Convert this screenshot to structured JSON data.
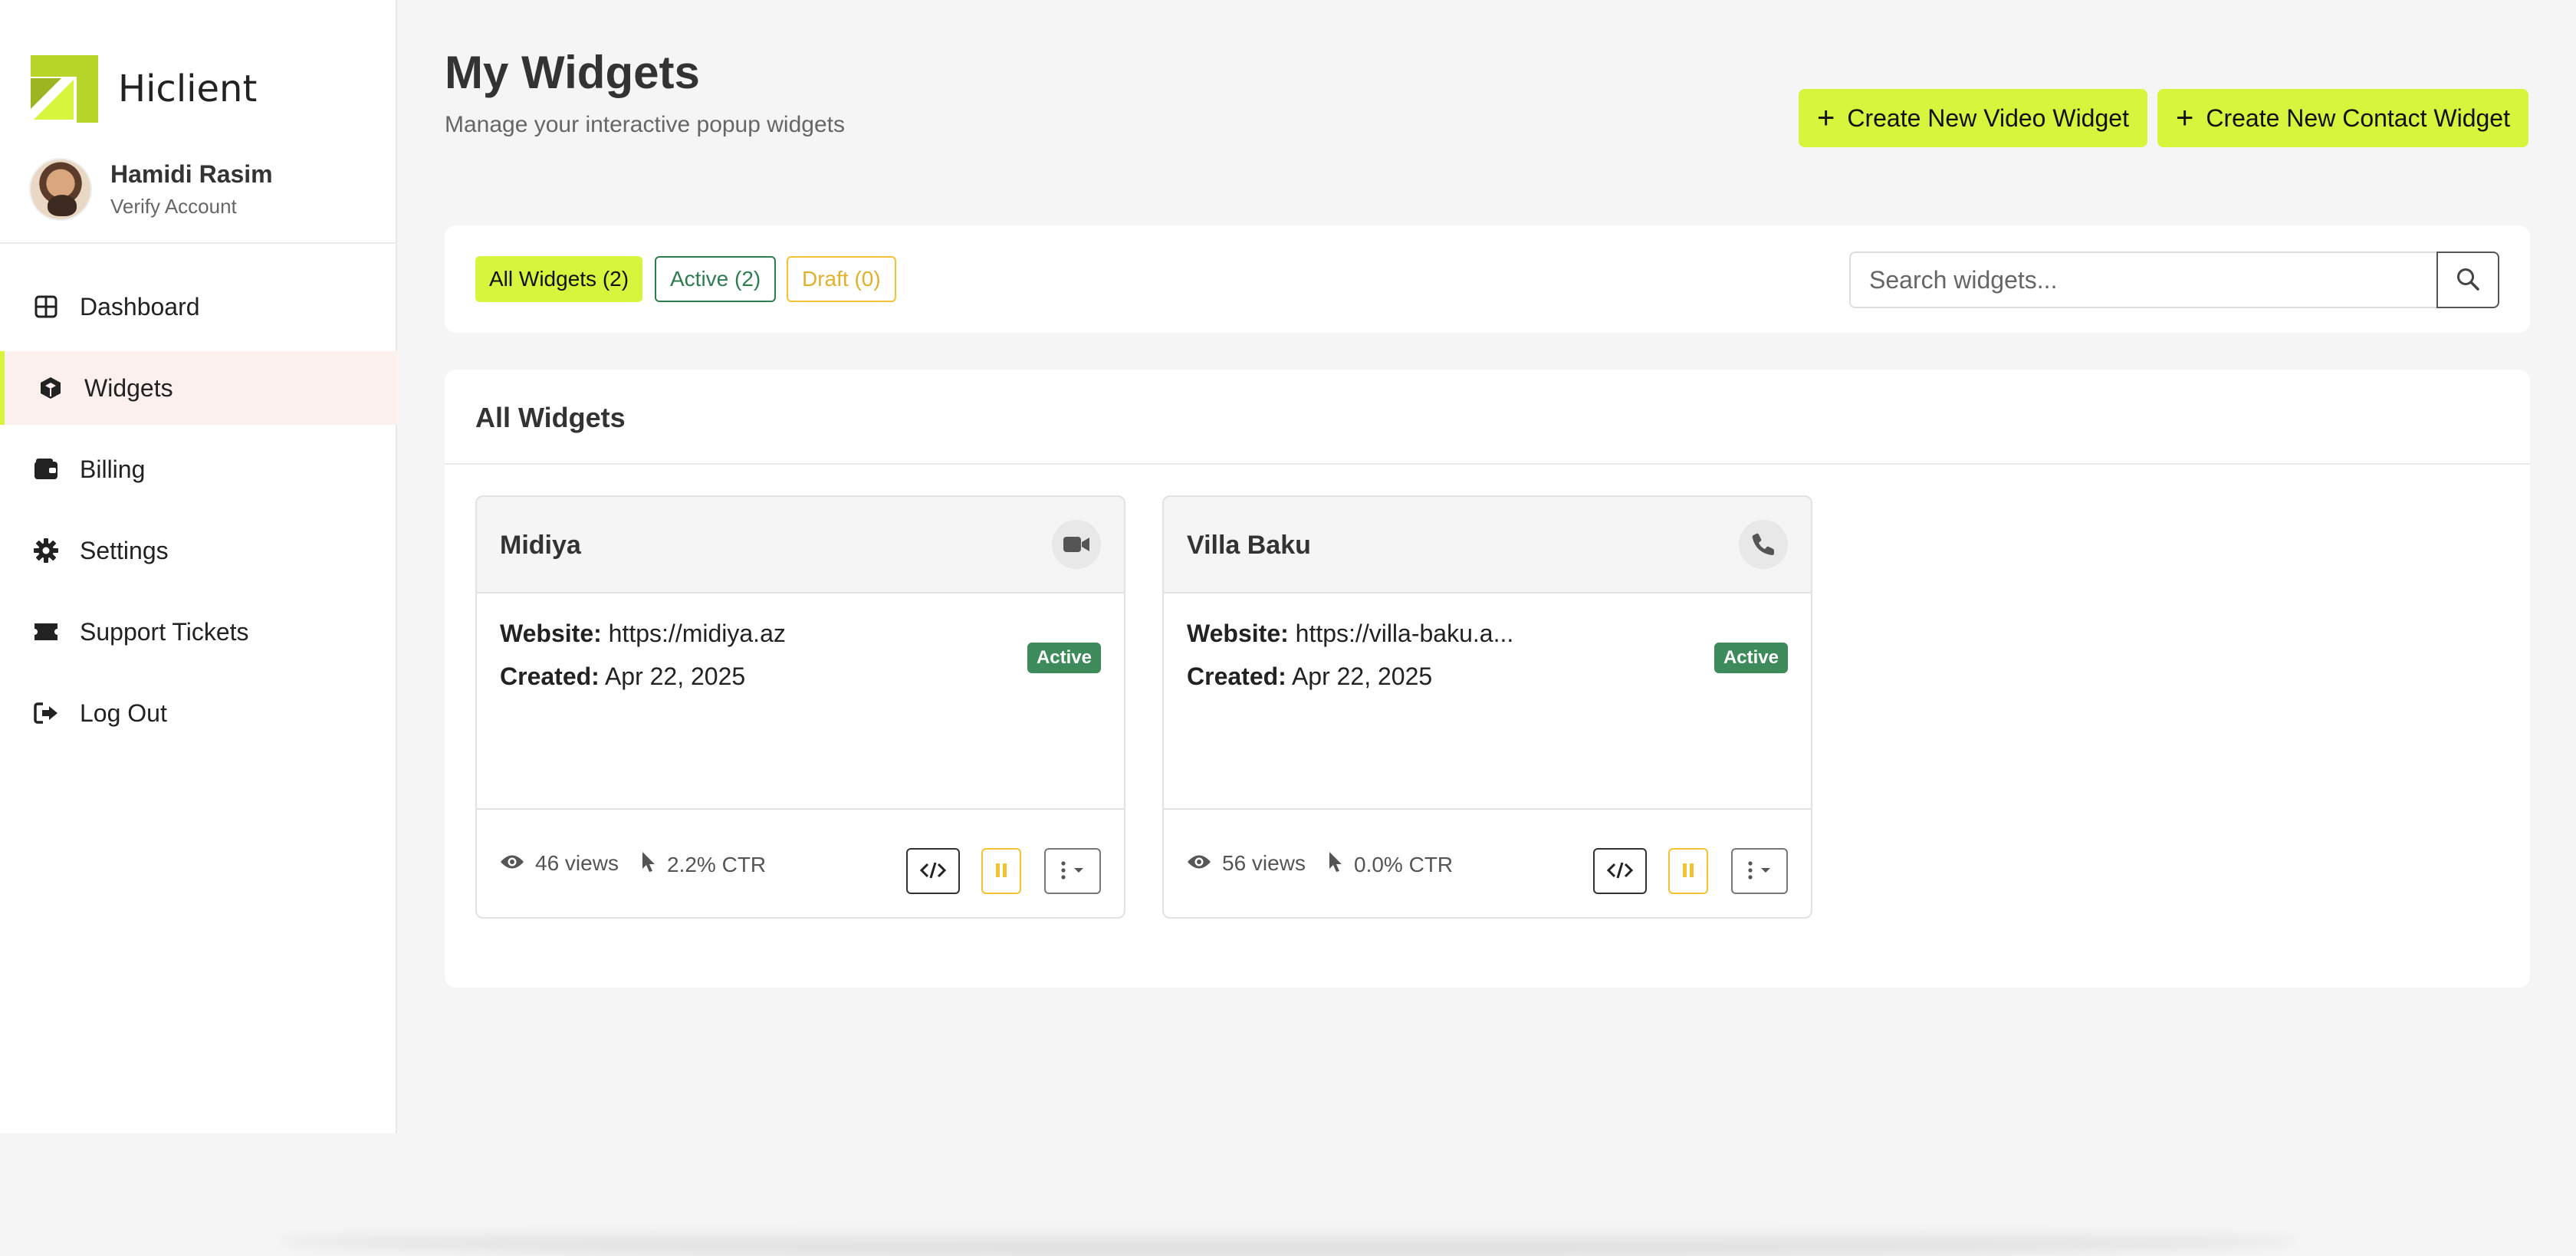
{
  "brand": {
    "name": "Hiclient",
    "accent": "#d6f53c"
  },
  "profile": {
    "name": "Hamidi Rasim",
    "subtitle": "Verify Account"
  },
  "nav": {
    "items": [
      {
        "label": "Dashboard",
        "icon": "grid-icon"
      },
      {
        "label": "Widgets",
        "icon": "cube-icon",
        "active": true
      },
      {
        "label": "Billing",
        "icon": "wallet-icon"
      },
      {
        "label": "Settings",
        "icon": "gear-icon"
      },
      {
        "label": "Support Tickets",
        "icon": "ticket-icon"
      },
      {
        "label": "Log Out",
        "icon": "logout-icon"
      }
    ]
  },
  "header": {
    "title": "My Widgets",
    "subtitle": "Manage your interactive popup widgets",
    "btn_video": "Create New Video Widget",
    "btn_contact": "Create New Contact Widget",
    "plus": "+"
  },
  "filters": {
    "all": "All Widgets (2)",
    "active": "Active (2)",
    "draft": "Draft (0)"
  },
  "search": {
    "placeholder": "Search widgets...",
    "value": ""
  },
  "widgets_panel": {
    "title": "All Widgets",
    "cards": [
      {
        "name": "Midiya",
        "type_icon": "video-camera-icon",
        "website_label": "Website:",
        "website": "https://midiya.az",
        "created_label": "Created:",
        "created": "Apr 22, 2025",
        "status": "Active",
        "views": "46 views",
        "ctr": "2.2% CTR"
      },
      {
        "name": "Villa Baku",
        "type_icon": "phone-icon",
        "website_label": "Website:",
        "website": "https://villa-baku.a...",
        "created_label": "Created:",
        "created": "Apr 22, 2025",
        "status": "Active",
        "views": "56 views",
        "ctr": "0.0% CTR"
      }
    ]
  }
}
